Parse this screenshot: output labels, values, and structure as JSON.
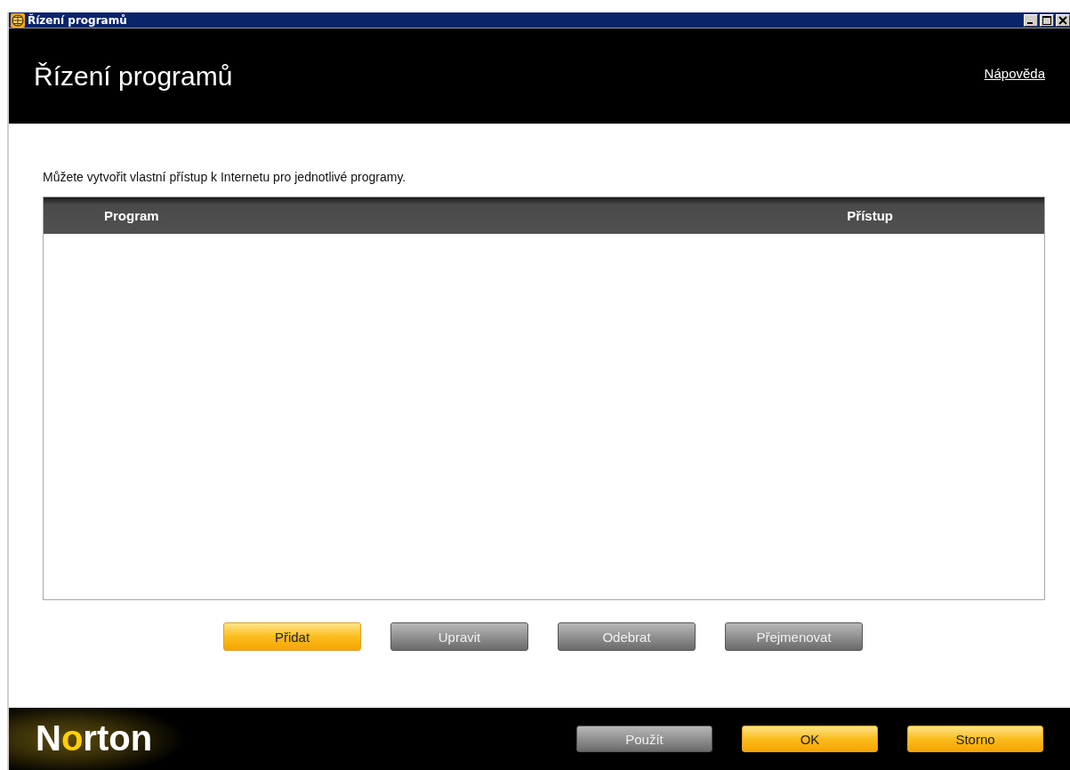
{
  "window": {
    "title": "Řízení programů"
  },
  "header": {
    "title": "Řízení programů",
    "help_link": "Nápověda"
  },
  "description": "Můžete vytvořit vlastní přístup k Internetu pro jednotlivé programy.",
  "table": {
    "columns": [
      "Program",
      "Přístup"
    ]
  },
  "actions": [
    {
      "label": "Přidat",
      "disabled": false
    },
    {
      "label": "Upravit",
      "disabled": true
    },
    {
      "label": "Odebrat",
      "disabled": true
    },
    {
      "label": "Přejmenovat",
      "disabled": true
    }
  ],
  "footer": {
    "logo": "Norton",
    "buttons": [
      {
        "label": "Použít",
        "disabled": true
      },
      {
        "label": "OK",
        "disabled": false
      },
      {
        "label": "Storno",
        "disabled": false
      }
    ]
  }
}
